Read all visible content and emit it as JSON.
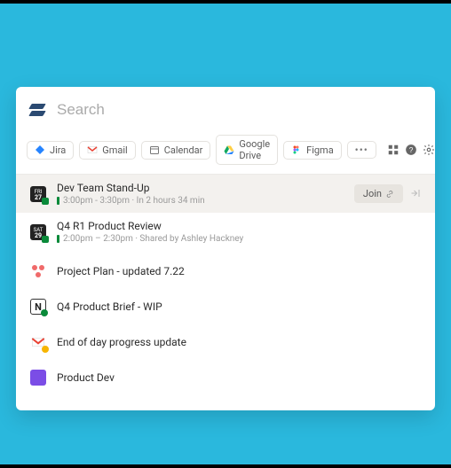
{
  "search": {
    "placeholder": "Search"
  },
  "chips": {
    "jira": "Jira",
    "gmail": "Gmail",
    "calendar": "Calendar",
    "gdrive": "Google Drive",
    "figma": "Figma"
  },
  "items": [
    {
      "title": "Dev Team Stand-Up",
      "sub": "3:00pm - 3:30pm · In 2 hours 34 min",
      "join": "Join"
    },
    {
      "title": "Q4 R1 Product Review",
      "sub": "2:00pm – 2:30pm · Shared by Ashley Hackney"
    },
    {
      "title": "Project Plan - updated 7.22"
    },
    {
      "title": "Q4 Product Brief - WIP"
    },
    {
      "title": "End of day progress update"
    },
    {
      "title": "Product Dev"
    }
  ]
}
